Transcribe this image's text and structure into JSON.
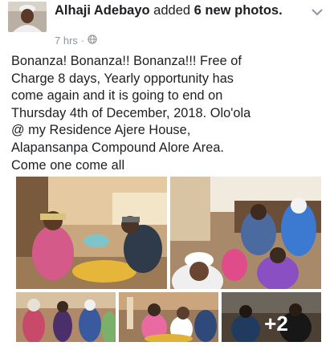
{
  "post": {
    "author": "Alhaji Adebayo",
    "action_prefix": "added",
    "action_strong": "6 new",
    "action_suffix": "photos.",
    "time": "7 hrs",
    "separator": "·",
    "privacy_icon": "globe-icon",
    "menu_icon": "chevron-down-icon",
    "text": "Bonanza! Bonanza!! Bonanza!!! Free of\nCharge 8 days, Yearly opportunity has\ncome again and it is going to end on\nThursday 4th of December, 2018. Olo'ola\n@ my Residence Ajere House,\nAlapansanpa Compound Alore Area.\nCome one come all"
  },
  "photos": {
    "count": 6,
    "more_label": "+2"
  },
  "colors": {
    "text": "#1c1e21",
    "meta": "#90949c"
  }
}
